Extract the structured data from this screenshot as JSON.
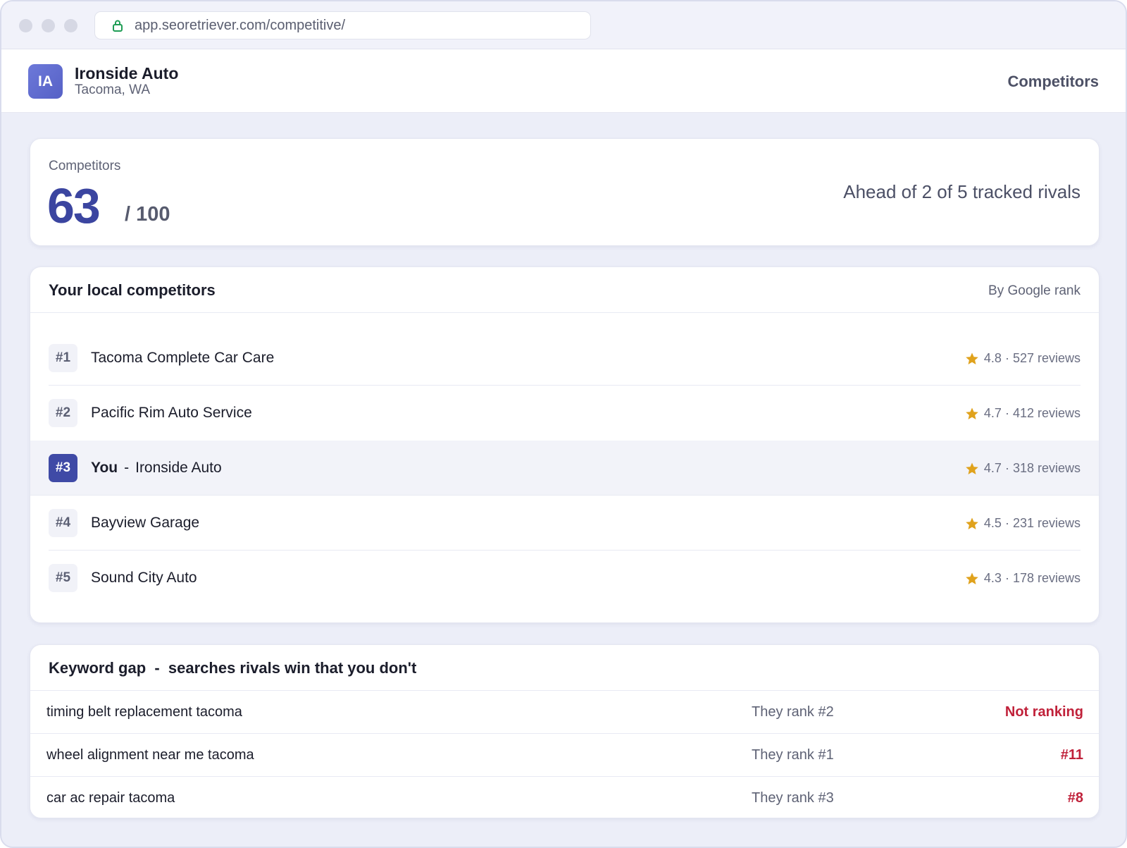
{
  "browser": {
    "url": "app.seoretriever.com/competitive/"
  },
  "header": {
    "avatar_initials": "IA",
    "business_name": "Ironside Auto",
    "business_location": "Tacoma, WA",
    "nav_title": "Competitors"
  },
  "score": {
    "label": "Competitors",
    "value": "63",
    "max": "/ 100",
    "summary": "Ahead of 2 of 5 tracked rivals"
  },
  "competitors": {
    "title": "Your local competitors",
    "sort_label": "By Google rank",
    "items": [
      {
        "rank": "#1",
        "name": "Tacoma Complete Car Care",
        "rating": "4.8 · 527 reviews"
      },
      {
        "rank": "#2",
        "name": "Pacific Rim Auto Service",
        "rating": "4.7 · 412 reviews"
      },
      {
        "rank": "#3",
        "you_label": "You",
        "separator": "-",
        "name": "Ironside Auto",
        "rating": "4.7 · 318 reviews"
      },
      {
        "rank": "#4",
        "name": "Bayview Garage",
        "rating": "4.5 · 231 reviews"
      },
      {
        "rank": "#5",
        "name": "Sound City Auto",
        "rating": "4.3 · 178 reviews"
      }
    ]
  },
  "keyword_gap": {
    "title": "Keyword gap  -  searches rivals win that you don't",
    "rows": [
      {
        "term": "timing belt replacement tacoma",
        "they_rank": "They rank #2",
        "your_rank": "Not ranking"
      },
      {
        "term": "wheel alignment near me tacoma",
        "they_rank": "They rank #1",
        "your_rank": "#11"
      },
      {
        "term": "car ac repair tacoma",
        "they_rank": "They rank #3",
        "your_rank": "#8"
      }
    ]
  },
  "colors": {
    "accent": "#3f4aa6",
    "star": "#e0a21c",
    "negative": "#c0213a",
    "background": "#eceef8"
  },
  "icons": {
    "lock": "lock-icon",
    "star": "star-icon"
  }
}
